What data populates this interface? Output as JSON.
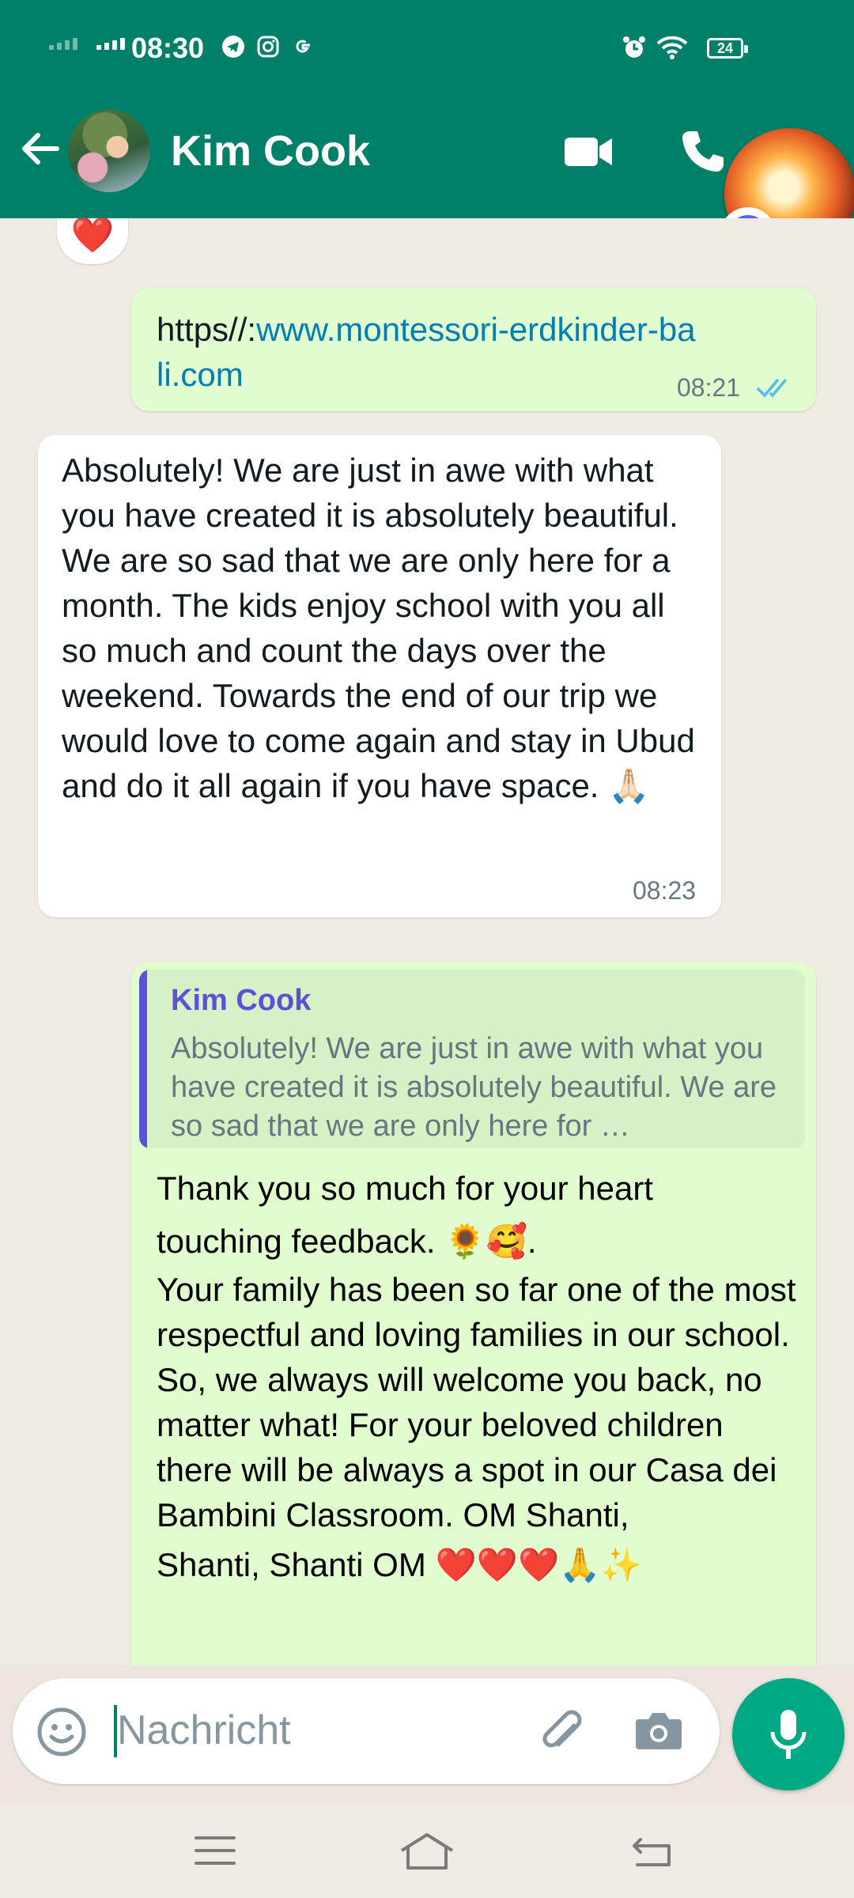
{
  "status_bar": {
    "time": "08:30",
    "battery": "24",
    "icons": [
      "telegram-icon",
      "instagram-icon",
      "google-icon",
      "alarm-icon",
      "wifi-icon",
      "battery-icon"
    ]
  },
  "header": {
    "contact_name": "Kim Cook",
    "actions": [
      "video-call-icon",
      "voice-call-icon"
    ]
  },
  "messages": [
    {
      "direction": "out",
      "text_prefix": "https//:",
      "link": "www.montessori-erdkinder-ba li.com",
      "link_line1": "www.montessori-erdkinder-ba",
      "link_line2": "li.com",
      "time": "08:21",
      "status": "read"
    },
    {
      "direction": "in",
      "text": "Absolutely! We are just in awe with what you have created it is absolutely beautiful. We are so sad that we are only here for a month. The kids enjoy school with you all so much and count the days over the weekend. Towards the end of our trip we would love to come again and stay in Ubud and do it all again if you have space. 🙏🏻",
      "time": "08:23"
    },
    {
      "direction": "out",
      "reply_to": {
        "name": "Kim Cook",
        "text": "Absolutely! We are just in awe with what you have created it is absolutely beautiful. We are so sad that we are only here for …"
      },
      "line1": "Thank you so much for your heart",
      "line2": "touching feedback. 🌻🥰.",
      "text": "Your family has been so far one of the most respectful and loving families in our school. So, we always will welcome you back, no matter what! For your beloved children there will be always a spot in our Casa dei Bambini Classroom. OM Shanti,",
      "last_line": "Shanti, Shanti OM ❤️❤️❤️🙏✨"
    }
  ],
  "reaction": "❤️",
  "composer": {
    "placeholder": "Nachricht"
  },
  "colors": {
    "header": "#008069",
    "outgoing_bubble": "#e1fccf",
    "incoming_bubble": "#ffffff",
    "link": "#027eb5",
    "reply_accent": "#5d4fd6",
    "mic_button": "#00a884"
  }
}
